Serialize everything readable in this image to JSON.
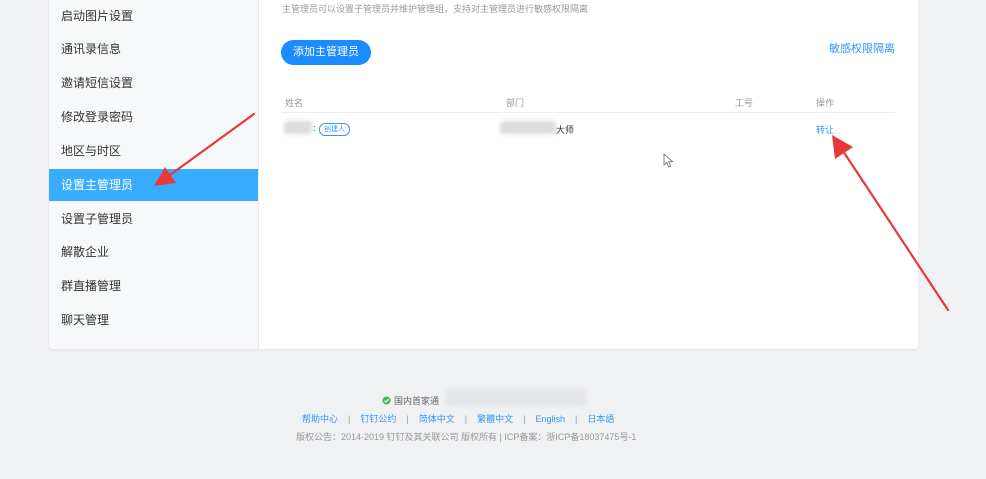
{
  "sidebar": {
    "items": [
      {
        "label": "启动图片设置"
      },
      {
        "label": "通讯录信息"
      },
      {
        "label": "邀请短信设置"
      },
      {
        "label": "修改登录密码"
      },
      {
        "label": "地区与时区"
      },
      {
        "label": "设置主管理员",
        "active": true
      },
      {
        "label": "设置子管理员"
      },
      {
        "label": "解散企业"
      },
      {
        "label": "群直播管理"
      },
      {
        "label": "聊天管理"
      }
    ]
  },
  "main": {
    "description": "主管理员可以设置子管理员并维护管理组，支持对主管理员进行敏感权限隔离",
    "add_button": "添加主管理员",
    "sensitive_link": "敏感权限隔离",
    "table": {
      "headers": [
        "姓名",
        "部门",
        "工号",
        "操作"
      ],
      "row": {
        "name_suffix": ":",
        "badge": "创建人",
        "department_suffix": "大师",
        "action": "转让"
      }
    }
  },
  "footer": {
    "trust_text": "国内首家通",
    "links": [
      "帮助中心",
      "钉钉公约",
      "简体中文",
      "繁體中文",
      "English",
      "日本語"
    ],
    "copyright": "版权公告：2014-2019 钉钉及其关联公司 版权所有 | ICP备案：浙ICP备18037475号-1"
  },
  "colors": {
    "accent": "#1a8cff",
    "sidebar_active": "#38adff",
    "link": "#3296fa",
    "annotation_arrow": "#e8383a"
  }
}
